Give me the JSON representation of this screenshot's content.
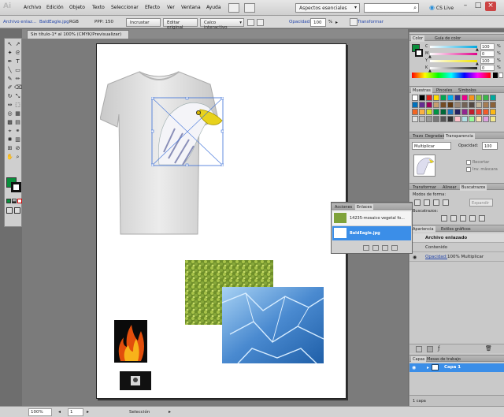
{
  "app": {
    "logo": "Ai",
    "menu": [
      "Archivo",
      "Edición",
      "Objeto",
      "Texto",
      "Seleccionar",
      "Efecto",
      "Ver",
      "Ventana",
      "Ayuda"
    ],
    "workspace": "Aspectos esenciales",
    "cs_live": "CS Live",
    "window_min": "–",
    "window_max": "□",
    "window_close": "×"
  },
  "control_bar": {
    "object_type": "Archivo enlaz...",
    "file_name": "BaldEagle.jpg",
    "color_mode": "RGB",
    "ppp_label": "PPP: 150",
    "embed_btn": "Incrustar",
    "edit_original_btn": "Editar original",
    "live_trace": "Calco interactivo",
    "opacity_label": "Opacidad:",
    "opacity_value": "100",
    "opacity_unit": "%",
    "transform_label": "Transformar"
  },
  "document": {
    "tab_title": "Sin título-1* al 100% (CMYK/Previsualizar)",
    "tab_close": "×"
  },
  "status": {
    "zoom": "100%",
    "page": "1",
    "selection": "Selección"
  },
  "panels": {
    "color": {
      "tabs": [
        "Color",
        "Guía de color"
      ],
      "channels": [
        {
          "label": "C",
          "value": "100",
          "fill": 1.0,
          "color": "#00a8e0"
        },
        {
          "label": "M",
          "value": "0",
          "fill": 0.0,
          "color": "#e0008a"
        },
        {
          "label": "Y",
          "value": "100",
          "fill": 1.0,
          "color": "#f2e500"
        },
        {
          "label": "K",
          "value": "0",
          "fill": 0.0,
          "color": "#222222"
        }
      ],
      "unit": "%"
    },
    "swatches": {
      "tabs": [
        "Muestras",
        "Pinceles",
        "Símbolos"
      ]
    },
    "transparency": {
      "tabs": [
        "Trazo",
        "Degradado",
        "Transparencia"
      ],
      "blend_mode": "Multiplicar",
      "opacity_label": "Opacidad:",
      "opacity_value": "100",
      "clip_label": "Recortar",
      "invert_label": "Inv. máscara"
    },
    "pathfinder": {
      "tabs": [
        "Transformar",
        "Alinear",
        "Buscatrazos"
      ],
      "shape_modes": "Modos de forma:",
      "expand_btn": "Expandir",
      "finders": "Buscatrazos:"
    },
    "appearance": {
      "tabs": [
        "Apariencia",
        "Estilos gráficos"
      ],
      "title": "Archivo enlazado",
      "content": "Contenido",
      "opacity_label": "Opacidad:",
      "opacity_value": "100% Multiplicar"
    },
    "layers": {
      "tabs": [
        "Capas",
        "Mesas de trabajo"
      ],
      "layer_name": "Capa 1",
      "count": "1 capa"
    },
    "links": {
      "tabs": [
        "Acciones",
        "Enlaces"
      ],
      "items": [
        "14235-mosaico vegetal fo...",
        "BaldEagle.jpg"
      ]
    }
  },
  "colors": {
    "accent": "#3b8ee8",
    "fill_green": "#0a8f3c",
    "selection": "#3a6fd8"
  }
}
